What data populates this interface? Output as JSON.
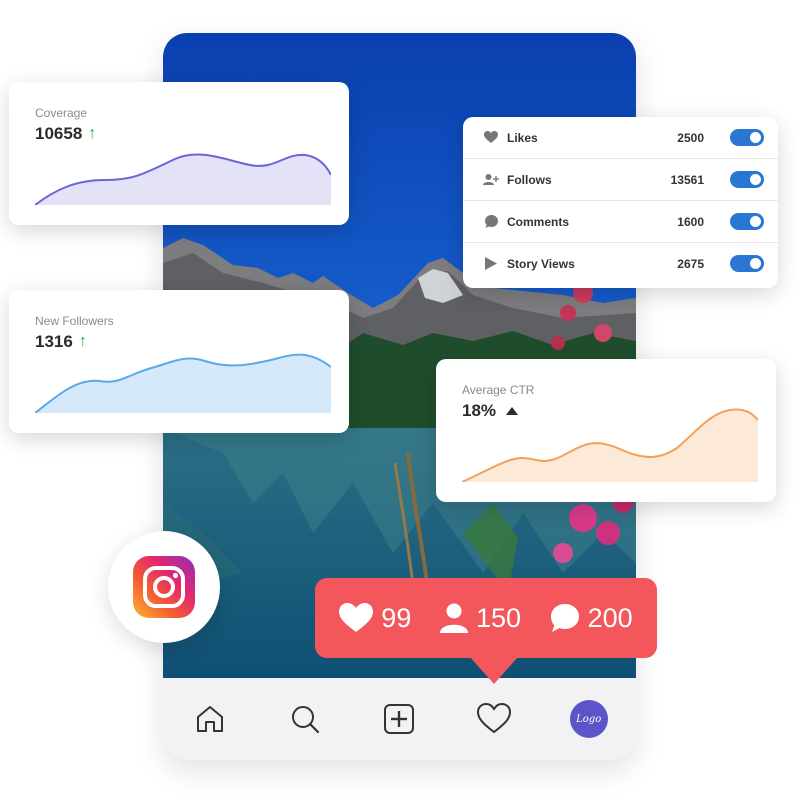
{
  "colors": {
    "coverage_line": "#6a64d8",
    "followers_line": "#5aaae8",
    "ctr_line": "#f3a15a",
    "toggle_on": "#2a76d3",
    "notification_bg": "#f4575b",
    "trend_up": "#25a53d"
  },
  "coverage_card": {
    "label": "Coverage",
    "value": "10658",
    "trend_icon": "arrow-up-icon"
  },
  "followers_card": {
    "label": "New Followers",
    "value": "1316",
    "trend_icon": "arrow-up-icon"
  },
  "ctr_card": {
    "label": "Average CTR",
    "value": "18%",
    "trend_icon": "triangle-up-icon"
  },
  "stats": [
    {
      "icon": "heart-icon",
      "label": "Likes",
      "value": "2500",
      "enabled": true
    },
    {
      "icon": "add-user-icon",
      "label": "Follows",
      "value": "13561",
      "enabled": true
    },
    {
      "icon": "comment-icon",
      "label": "Comments",
      "value": "1600",
      "enabled": true
    },
    {
      "icon": "play-icon",
      "label": "Story Views",
      "value": "2675",
      "enabled": true
    }
  ],
  "notification": {
    "likes": "99",
    "followers": "150",
    "comments": "200"
  },
  "bottom_nav": {
    "items": [
      "home-icon",
      "search-icon",
      "add-post-icon",
      "activity-heart-icon",
      "profile-logo"
    ],
    "profile_text": "Logo"
  }
}
